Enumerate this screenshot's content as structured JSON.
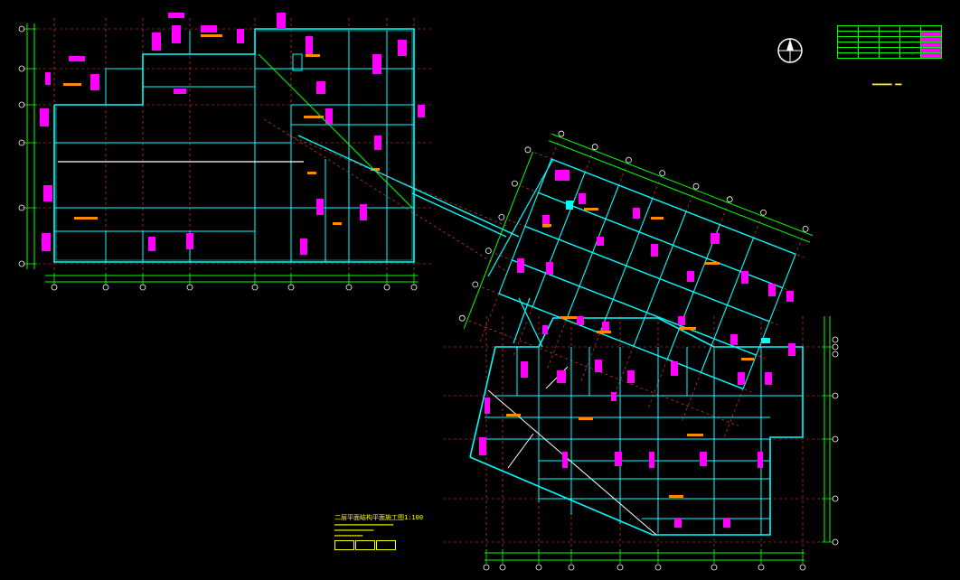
{
  "drawing": {
    "background": "#000000",
    "colors": {
      "wall": "#00ffff",
      "beam": "#40e0d0",
      "dim": "#00ff00",
      "axis": "#ff4040",
      "label": "#ffff00",
      "tag": "#ff00ff",
      "text": "#ff8c00",
      "white": "#ffffff"
    }
  },
  "legend_table": {
    "rows": 6,
    "cols": 5
  },
  "notes": {
    "title": "二层平面结构平面施工图1:100",
    "stamps": [
      "",
      "",
      ""
    ]
  },
  "axis_bubbles_left_bottom": [
    "",
    "",
    "",
    "",
    "",
    "",
    "",
    "",
    ""
  ],
  "axis_bubbles_left_side": [
    "",
    "",
    "",
    "",
    ""
  ]
}
